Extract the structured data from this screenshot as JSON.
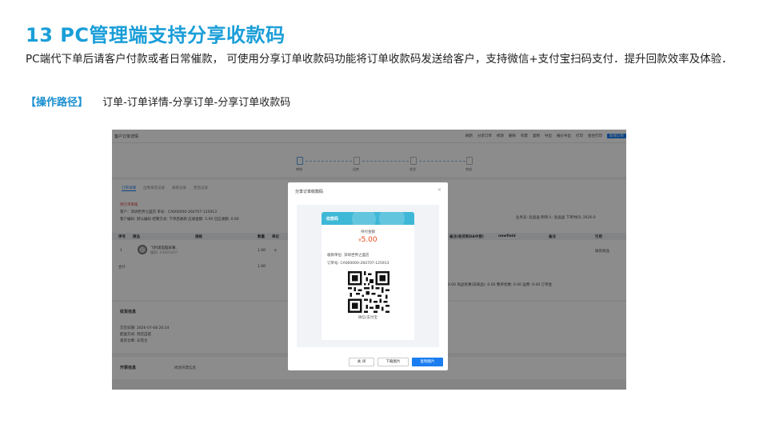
{
  "slide": {
    "title": "13  PC管理端支持分享收款码",
    "description": "PC端代下单后请客户付款或者日常催款，  可使用分享订单收款码功能将订单收款码发送给客户，支持微信+支付宝扫码支付．提升回款效率及体验．",
    "path_label": "【操作路径】",
    "path_value": "订单-订单详情-分享订单-分享订单收款码"
  },
  "screenshot": {
    "page_title": "客户订单详情",
    "toolbar": [
      "刷新",
      "分享订单",
      "修改",
      "删除",
      "作废",
      "复制",
      "导出",
      "报价导出",
      "打印",
      "组合打印",
      "新增订单"
    ],
    "steps": [
      "审核",
      "出库",
      "发货",
      "完成"
    ],
    "tabs": [
      "订单详情",
      "出库发货记录",
      "收款记录",
      "售后记录"
    ],
    "status": "待订单审核",
    "customer_line": "客户：深圳世界之盛店    单号：CA000000-260707-125913",
    "meta_line": "客户编码: 默认编码    结算方式: 下单后收款    应收金额: 5.00  已应收额: 0.00",
    "right_meta": "业务员: 赵晶晶     制单人: 赵晶晶     下单时间: 2026-0",
    "table_headers": [
      "序号",
      "商品",
      "规格",
      "数量",
      "单位",
      "备注(收货和DA中使)",
      "newfield",
      "备注",
      "引用"
    ],
    "row": {
      "index": "1",
      "name": "飞利浦电脑屏幕..",
      "code": "编码: 03001857",
      "qty": "1.00",
      "unit": "个",
      "ref": "缺货商品"
    },
    "total_label": "合计",
    "total_qty": "1.00",
    "summary": "0.00    商品优惠(非商品): 0.00    整单优惠: 0.00    运费: 0.00    订单金",
    "delivery_title": "收货信息",
    "delivery_lines": [
      "交货日期: 2026-07-08 20:24",
      "配送方式: 到店自提",
      "发货仓库: 东莞仓"
    ],
    "invoice_title": "开票信息",
    "invoice_edit": "修改开票信息"
  },
  "modal": {
    "title": "分享订单收款码",
    "close": "×",
    "card_title": "收款码",
    "amount_label": "待付金额",
    "currency": "¥",
    "amount": "5.00",
    "payee_label": "收款单位:",
    "payee": "深圳世界之盛店",
    "order_label": "订单号:",
    "order_no": "CA000000-260707-125913",
    "qr_caption": "微信/支付宝",
    "buttons": [
      "关 闭",
      "下载图片",
      "复制图片"
    ]
  },
  "colors": {
    "title": "#1a9ed8",
    "accent": "#1a7ef0",
    "card_header": "#3eb8d6",
    "amount": "#e8491d"
  }
}
